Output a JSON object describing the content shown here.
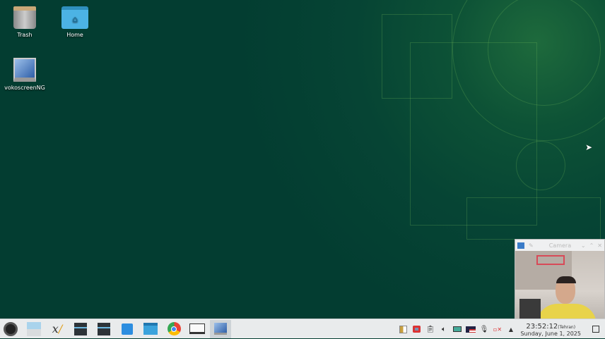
{
  "desktop": {
    "icons": [
      {
        "label": "Trash",
        "icon": "trash-icon"
      },
      {
        "label": "Home",
        "icon": "folder-home-icon"
      },
      {
        "label": "vokoscreenNG",
        "icon": "vokoscreen-icon"
      }
    ]
  },
  "camera_window": {
    "title": "Camera"
  },
  "taskbar": {
    "launchers": [
      "application-menu",
      "show-desktop",
      "xournal",
      "system-settings",
      "system-settings-2",
      "discover",
      "file-manager",
      "chrome",
      "terminal",
      "vokoscreenNG"
    ]
  },
  "clock": {
    "time": "23:52:12",
    "timezone": "(Tehran)",
    "date": "Sunday, June 1, 2025"
  }
}
